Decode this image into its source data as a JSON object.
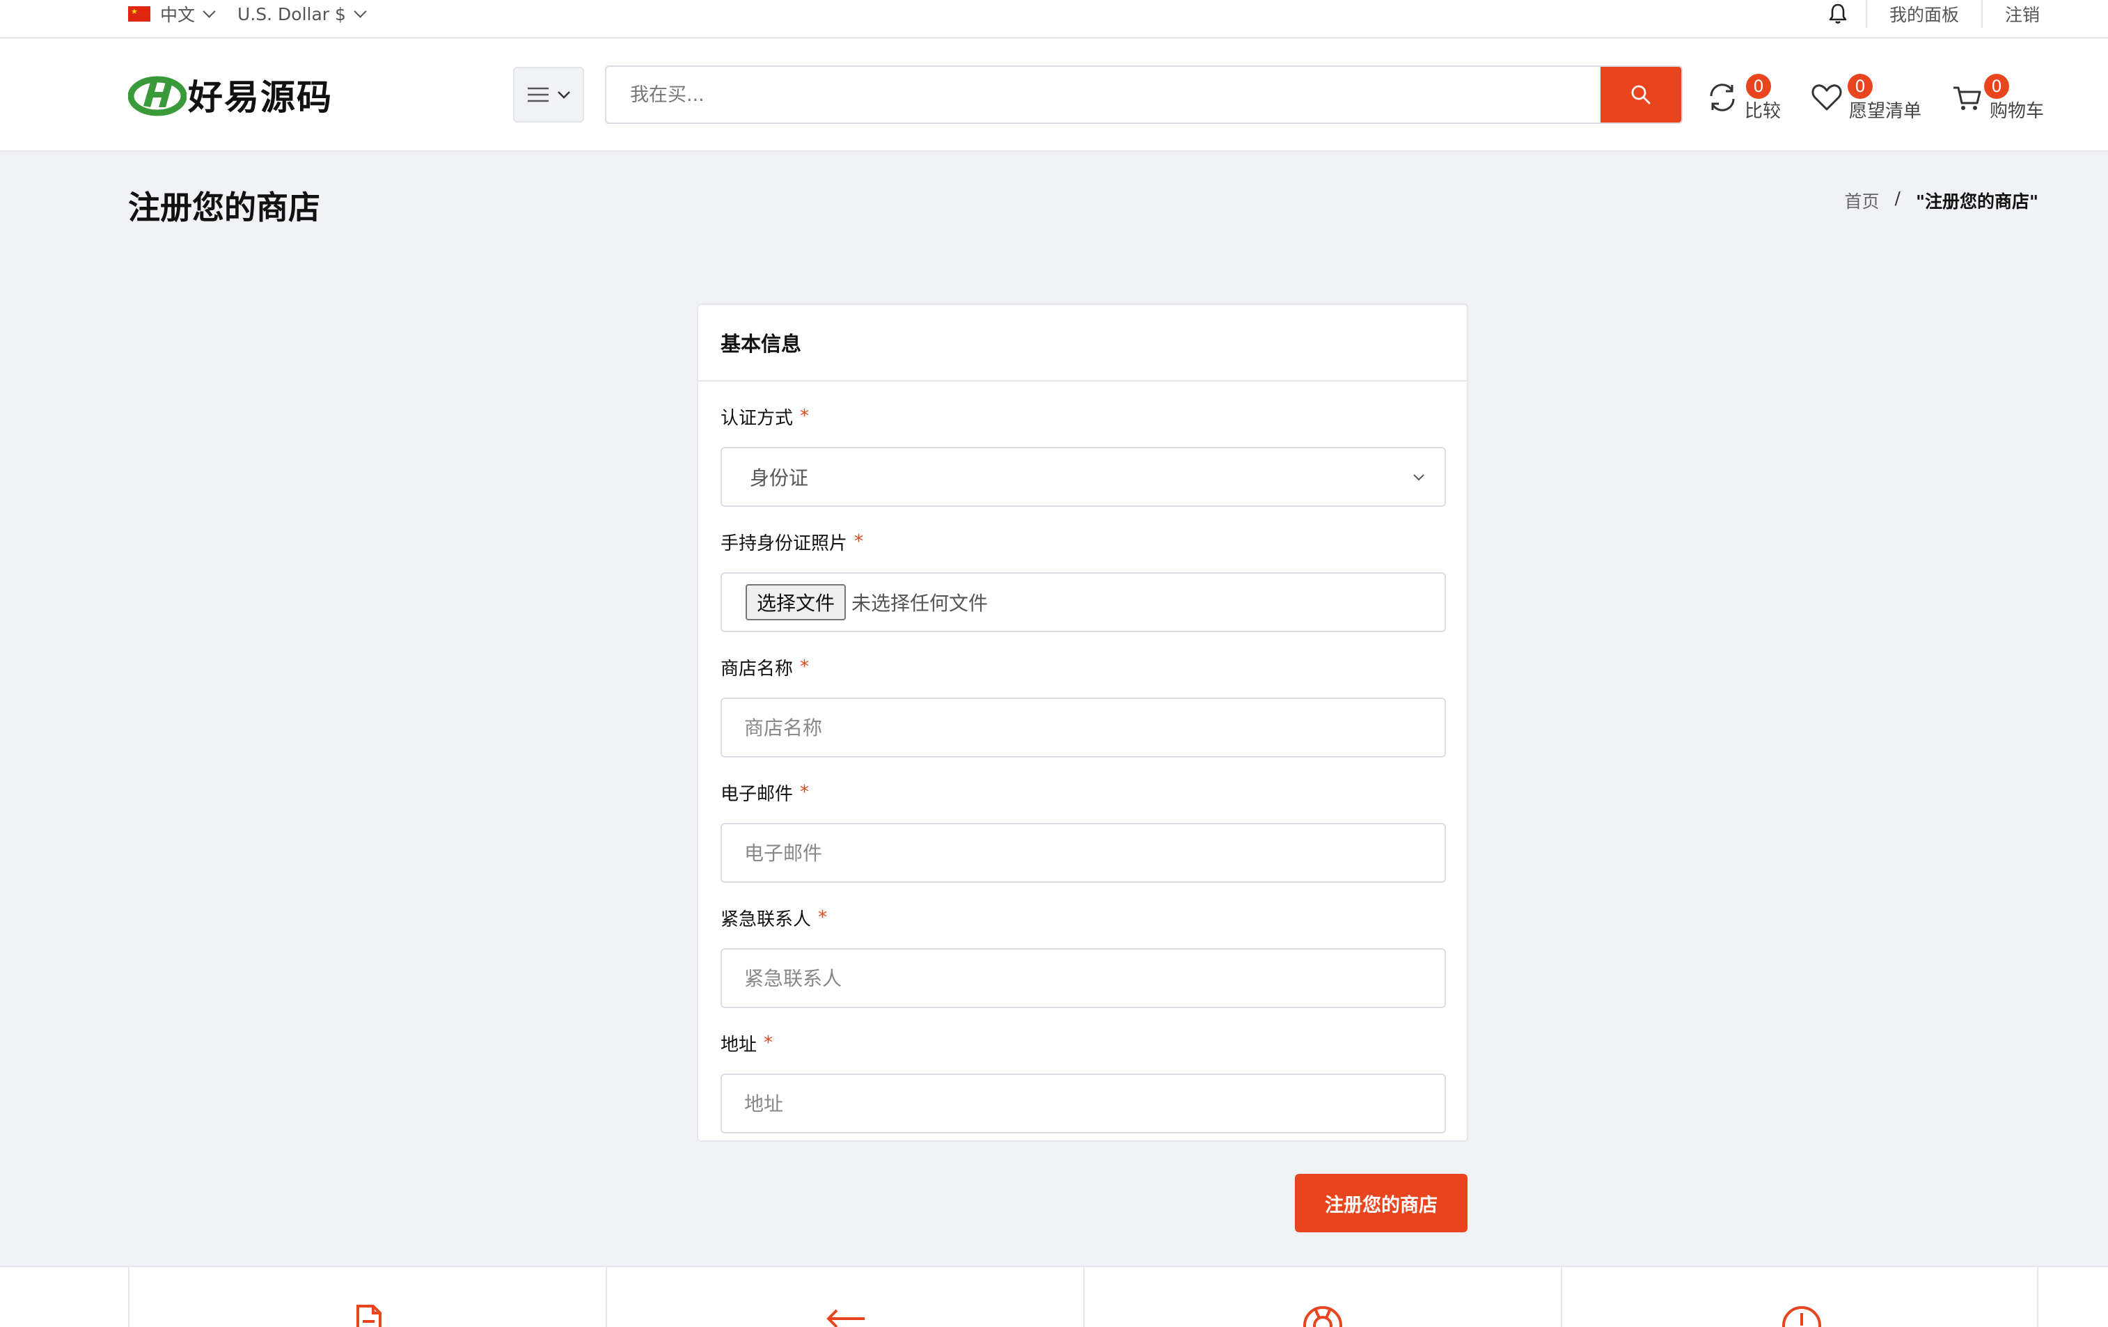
{
  "topbar": {
    "language": "中文",
    "currency": "U.S. Dollar $",
    "dashboard": "我的面板",
    "logout": "注销"
  },
  "header": {
    "logo_text": "好易源码",
    "search_placeholder": "我在买...",
    "compare_label": "比较",
    "compare_count": "0",
    "wishlist_label": "愿望清单",
    "wishlist_count": "0",
    "cart_label": "购物车",
    "cart_count": "0"
  },
  "page": {
    "title": "注册您的商店",
    "breadcrumb_home": "首页",
    "breadcrumb_sep": "/",
    "breadcrumb_current": "\"注册您的商店\""
  },
  "form": {
    "card_title": "基本信息",
    "auth_label": "认证方式",
    "auth_value": "身份证",
    "photo_label": "手持身份证照片",
    "file_button": "选择文件",
    "file_status": "未选择任何文件",
    "shop_name_label": "商店名称",
    "shop_name_placeholder": "商店名称",
    "email_label": "电子邮件",
    "email_placeholder": "电子邮件",
    "contact_label": "紧急联系人",
    "contact_placeholder": "紧急联系人",
    "address_label": "地址",
    "address_placeholder": "地址",
    "required_mark": "*",
    "submit_label": "注册您的商店"
  },
  "colors": {
    "accent": "#e8451e",
    "background": "#f1f2f6",
    "logo_green": "#3a9a3a"
  },
  "icons": [
    "bell-icon",
    "menu-icon",
    "search-icon",
    "compare-icon",
    "heart-icon",
    "cart-icon",
    "document-icon",
    "return-icon",
    "support-icon",
    "clock-icon"
  ]
}
